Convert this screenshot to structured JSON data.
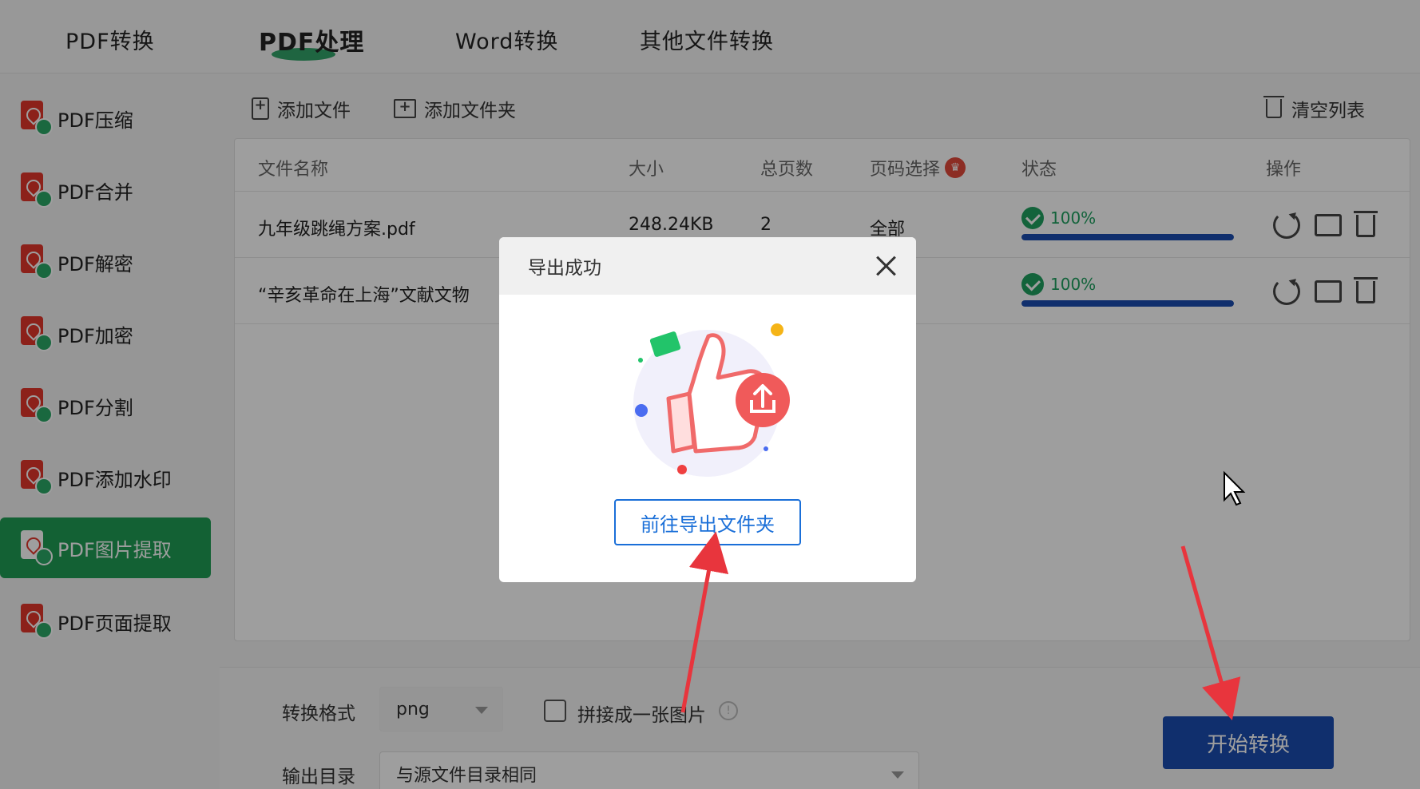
{
  "top_tabs": [
    {
      "label": "PDF转换"
    },
    {
      "label": "PDF处理"
    },
    {
      "label": "Word转换"
    },
    {
      "label": "其他文件转换"
    }
  ],
  "sidebar": {
    "items": [
      {
        "label": "PDF压缩"
      },
      {
        "label": "PDF合并"
      },
      {
        "label": "PDF解密"
      },
      {
        "label": "PDF加密"
      },
      {
        "label": "PDF分割"
      },
      {
        "label": "PDF添加水印"
      },
      {
        "label": "PDF图片提取"
      },
      {
        "label": "PDF页面提取"
      }
    ],
    "active_index": 6
  },
  "toolbar": {
    "add_file": "添加文件",
    "add_folder": "添加文件夹",
    "clear_list": "清空列表"
  },
  "table": {
    "headers": {
      "name": "文件名称",
      "size": "大小",
      "pages": "总页数",
      "page_select": "页码选择",
      "status": "状态",
      "actions": "操作"
    },
    "rows": [
      {
        "name": "九年级跳绳方案.pdf",
        "size": "248.24KB",
        "pages": "2",
        "page_select": "全部",
        "status": "100%",
        "progress": 100
      },
      {
        "name": "“辛亥革命在上海”文献文物",
        "size": "",
        "pages": "",
        "page_select": "",
        "status": "100%",
        "progress": 100
      }
    ]
  },
  "settings": {
    "format_label": "转换格式",
    "format_value": "png",
    "merge_label": "拼接成一张图片",
    "output_label": "输出目录",
    "output_value": "与源文件目录相同",
    "start_button": "开始转换"
  },
  "modal": {
    "title": "导出成功",
    "button": "前往导出文件夹"
  },
  "colors": {
    "accent_green": "#1f9d55",
    "primary_blue": "#1a4db0",
    "link_blue": "#1a6fd8",
    "pdf_red": "#e2362b"
  }
}
